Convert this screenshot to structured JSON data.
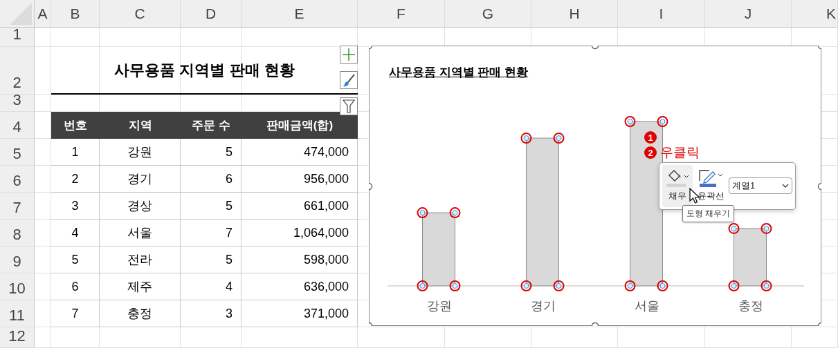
{
  "column_headers": [
    "A",
    "B",
    "C",
    "D",
    "E",
    "F",
    "G",
    "H",
    "I",
    "J",
    "K"
  ],
  "row_headers": [
    "1",
    "2",
    "3",
    "4",
    "5",
    "6",
    "7",
    "8",
    "9",
    "10",
    "11",
    "12"
  ],
  "table": {
    "title": "사무용품 지역별 판매 현황",
    "columns": [
      "번호",
      "지역",
      "주문 수",
      "판매금액(합)"
    ],
    "rows": [
      [
        "1",
        "강원",
        "5",
        "474,000"
      ],
      [
        "2",
        "경기",
        "6",
        "956,000"
      ],
      [
        "3",
        "경상",
        "5",
        "661,000"
      ],
      [
        "4",
        "서울",
        "7",
        "1,064,000"
      ],
      [
        "5",
        "전라",
        "5",
        "598,000"
      ],
      [
        "6",
        "제주",
        "4",
        "636,000"
      ],
      [
        "7",
        "충정",
        "3",
        "371,000"
      ]
    ]
  },
  "chart": {
    "title": "사무용품 지역별 판매 현황",
    "categories": [
      {
        "label": "강원"
      },
      {
        "label": "경기"
      },
      {
        "label": "서울"
      },
      {
        "label": "충정"
      }
    ],
    "series_selected": true
  },
  "steps": [
    {
      "number": "1"
    },
    {
      "number": "2",
      "text": "우클릭"
    }
  ],
  "mini_toolbar": {
    "buttons": [
      {
        "kind": "fill",
        "label": "채우",
        "hovered": true
      },
      {
        "kind": "outline",
        "label": "윤곽선",
        "hovered": false
      }
    ],
    "series_dropdown": {
      "value": "계열1"
    },
    "tooltip": "도형 채우기"
  }
}
